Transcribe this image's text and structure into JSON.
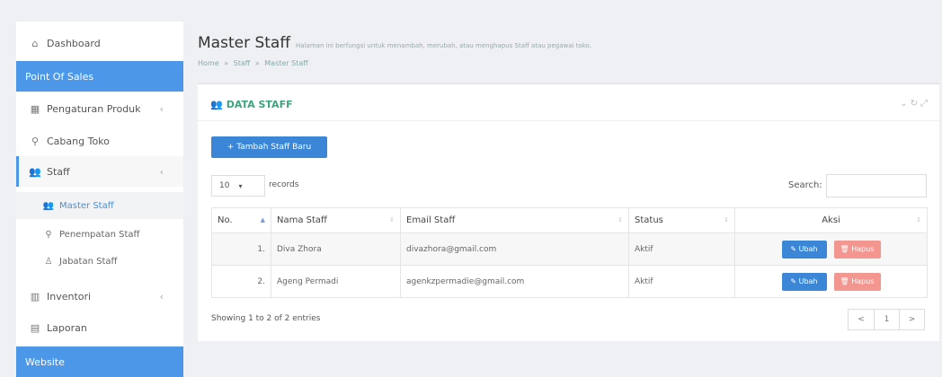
{
  "sidebar": {
    "items": [
      {
        "label": "Dashboard",
        "icon": "home-icon"
      },
      {
        "label": "Point Of Sales"
      },
      {
        "label": "Pengaturan Produk",
        "icon": "grid-icon"
      },
      {
        "label": "Cabang Toko",
        "icon": "map-marker-icon"
      },
      {
        "label": "Staff",
        "icon": "users-icon"
      },
      {
        "label": "Inventori",
        "icon": "building-icon"
      },
      {
        "label": "Laporan",
        "icon": "file-icon"
      },
      {
        "label": "Website"
      }
    ],
    "staff_sub": [
      {
        "label": "Master Staff",
        "icon": "users-icon"
      },
      {
        "label": "Penempatan Staff",
        "icon": "map-marker-icon"
      },
      {
        "label": "Jabatan Staff",
        "icon": "sitemap-icon"
      }
    ]
  },
  "header": {
    "title": "Master Staff",
    "subtitle": "Halaman ini berfungsi untuk menambah, merubah, atau menghapus Staff atau pegawai toko.",
    "breadcrumb": [
      "Home",
      "»",
      "Staff",
      "»",
      "Master Staff"
    ]
  },
  "panel": {
    "title": "DATA STAFF",
    "add_button": "+ Tambah Staff Baru",
    "records_value": "10",
    "records_label": "records",
    "search_label": "Search:",
    "columns": [
      "No.",
      "Nama Staff",
      "Email Staff",
      "Status",
      "Aksi"
    ],
    "rows": [
      {
        "no": "1.",
        "name": "Diva Zhora",
        "email": "divazhora@gmail.com",
        "status": "Aktif"
      },
      {
        "no": "2.",
        "name": "Ageng Permadi",
        "email": "agenkzpermadie@gmail.com",
        "status": "Aktif"
      }
    ],
    "edit_label": "✎ Ubah",
    "delete_label": "🗑 Hapus",
    "info": "Showing 1 to 2 of 2 entries",
    "pager": [
      "<",
      "1",
      ">"
    ]
  },
  "colors": {
    "accent": "#4c97e8",
    "button_primary": "#3b86d6",
    "button_danger": "#f3968f",
    "panel_title": "#3aa57c"
  }
}
